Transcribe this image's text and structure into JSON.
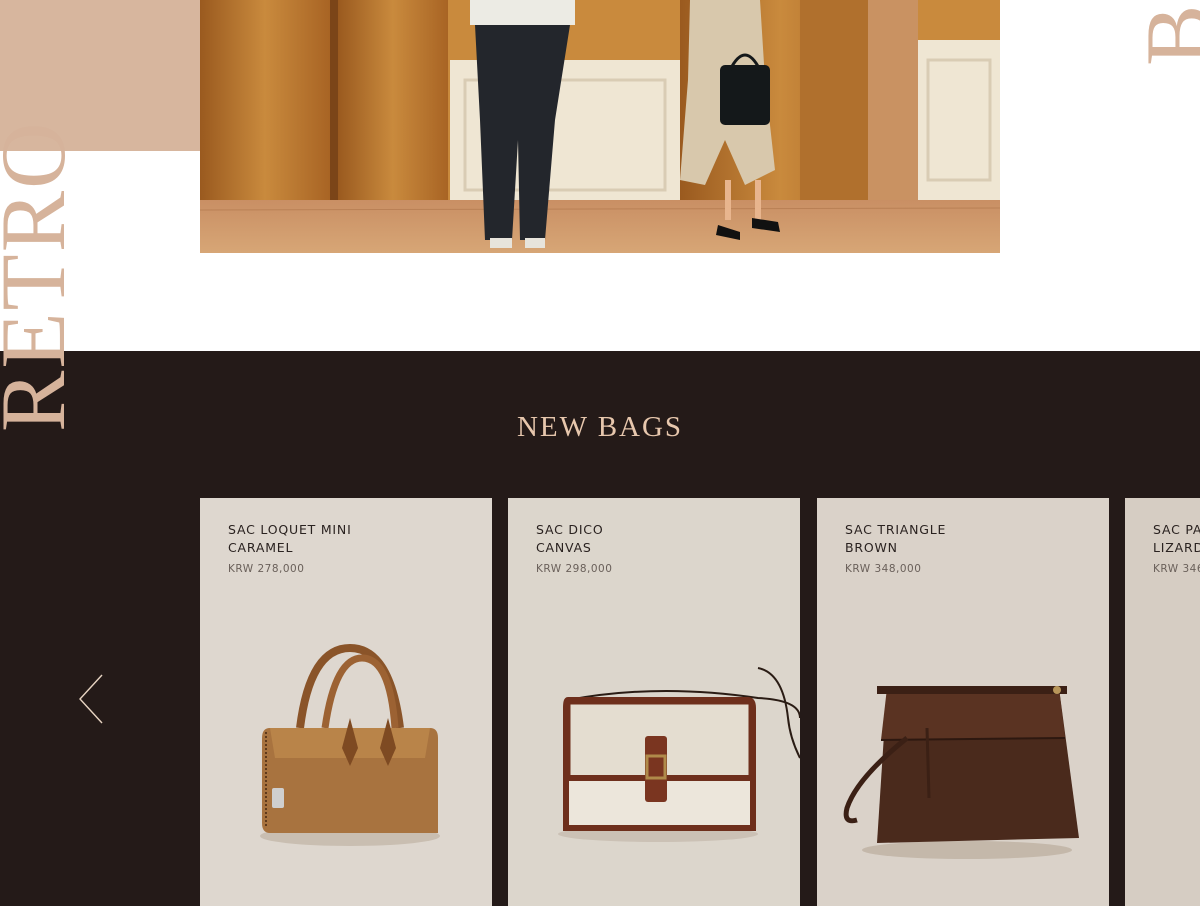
{
  "side_words": {
    "left": "RETRO",
    "right": "BE"
  },
  "section": {
    "title": "NEW BAGS"
  },
  "products": [
    {
      "name": "SAC LOQUET MINI\nCARAMEL",
      "price": "KRW 278,000"
    },
    {
      "name": "SAC DICO\nCANVAS",
      "price": "KRW 298,000"
    },
    {
      "name": "SAC TRIANGLE\nBROWN",
      "price": "KRW 348,000"
    },
    {
      "name": "SAC PA\nLIZARD",
      "price": "KRW 346"
    }
  ],
  "icons": {
    "prev": "chevron-left-icon"
  },
  "colors": {
    "tan": "#d7b69e",
    "dark_bg": "#241a18",
    "title": "#e7c7ad"
  }
}
